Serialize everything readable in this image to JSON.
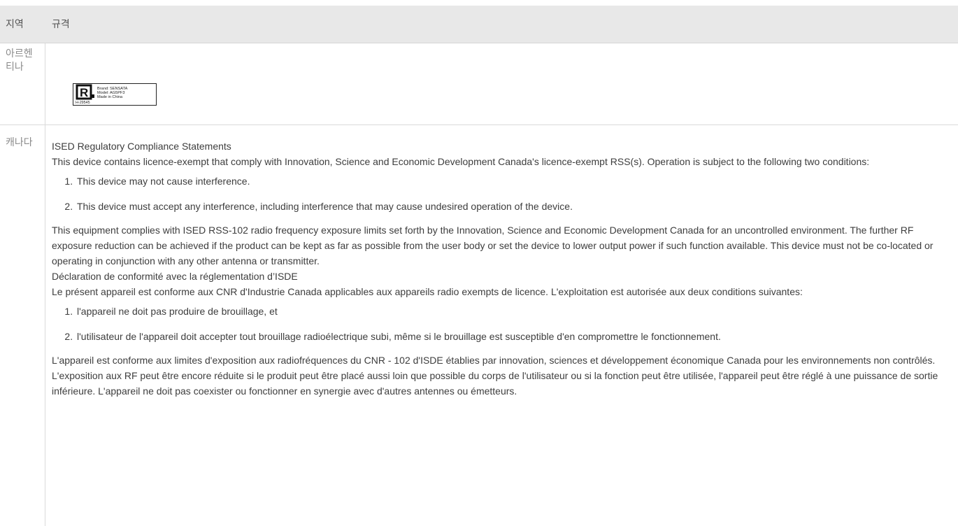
{
  "header": {
    "region_label": "지역",
    "spec_label": "규격"
  },
  "argentina": {
    "region": "아르헨티나",
    "label": {
      "mark": "R",
      "brand": "Brand: SENSATA",
      "model": "Model: AG5PF3",
      "made_in": "Made in China",
      "code": "H-29545"
    }
  },
  "canada": {
    "region": "캐나다",
    "ised_title": "ISED Regulatory Compliance Statements",
    "ised_intro": "This device contains licence-exempt that comply with Innovation, Science and Economic Development Canada's licence-exempt RSS(s). Operation is subject to the following two conditions:",
    "ised_conditions": [
      "This device may not cause interference.",
      "This device must accept any interference, including interference that may cause undesired operation of the device."
    ],
    "ised_exposure": "This equipment complies with ISED RSS-102 radio frequency exposure limits set forth by the Innovation, Science and Economic Development Canada for an uncontrolled environment. The further RF exposure reduction can be achieved if the product can be kept as far as possible from the user body or set the device to lower output power if such function available. This device must not be co-located or operating in conjunction with any other antenna or transmitter.",
    "fr_title": "Déclaration de conformité avec la réglementation d’ISDE",
    "fr_intro": "Le présent appareil est conforme aux CNR d'Industrie Canada applicables aux appareils radio exempts de licence. L'exploitation est autorisée aux deux conditions suivantes:",
    "fr_conditions": [
      "l'appareil ne doit pas produire de brouillage, et",
      "l'utilisateur de l'appareil doit accepter tout brouillage radioélectrique subi, même si le brouillage est susceptible d'en compromettre le fonctionnement."
    ],
    "fr_exposure": "L'appareil est conforme aux limites d'exposition aux radiofréquences du CNR - 102 d'ISDE établies par innovation, sciences et développement économique Canada pour les environnements non contrôlés. L'exposition aux RF peut être encore réduite si le produit peut être placé aussi loin que possible du corps de l'utilisateur ou si la fonction peut être utilisée, l'appareil peut être réglé à une puissance de sortie inférieure. L'appareil ne doit pas coexister ou fonctionner en synergie avec d'autres antennes ou émetteurs."
  }
}
